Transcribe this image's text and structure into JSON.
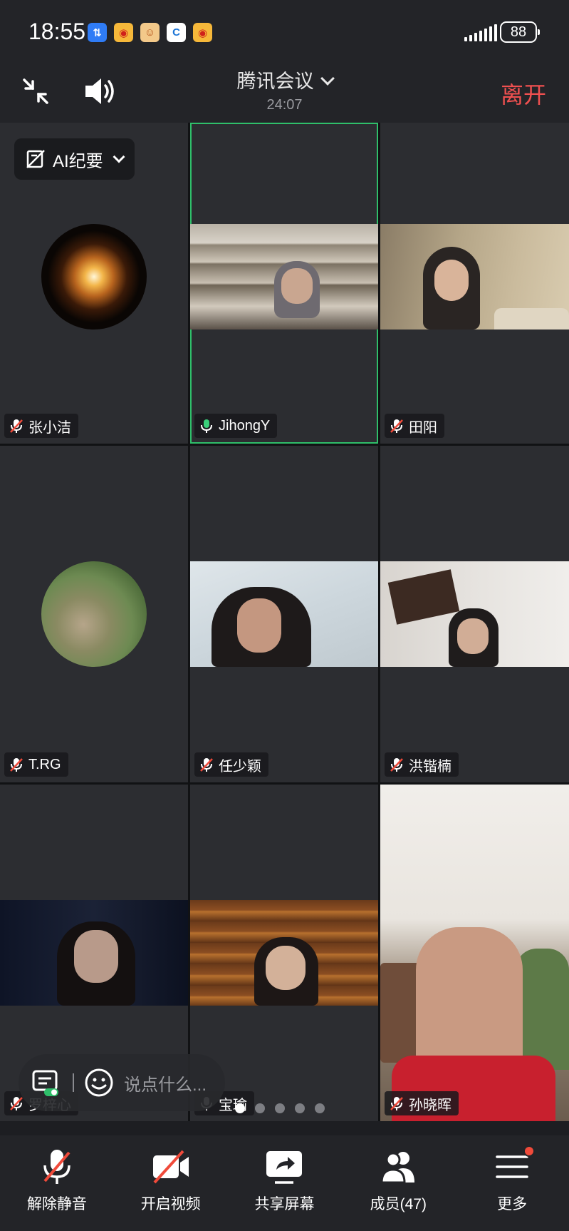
{
  "status_bar": {
    "time": "18:55",
    "battery": "88"
  },
  "header": {
    "title": "腾讯会议",
    "timer": "24:07",
    "leave_label": "离开"
  },
  "ai_summary": {
    "label": "AI纪要"
  },
  "participants": [
    {
      "name": "张小洁",
      "mic": "muted",
      "display": "avatar"
    },
    {
      "name": "JihongY",
      "mic": "on",
      "display": "video",
      "active": true
    },
    {
      "name": "田阳",
      "mic": "muted",
      "display": "video"
    },
    {
      "name": "T.RG",
      "mic": "muted",
      "display": "avatar"
    },
    {
      "name": "任少颖",
      "mic": "muted",
      "display": "video"
    },
    {
      "name": "洪锴楠",
      "mic": "muted",
      "display": "video"
    },
    {
      "name": "罗梓心",
      "mic": "muted",
      "display": "video"
    },
    {
      "name": "宝瑜",
      "mic": "on",
      "display": "video"
    },
    {
      "name": "孙晓晖",
      "mic": "muted",
      "display": "video"
    }
  ],
  "chat": {
    "placeholder": "说点什么..."
  },
  "pagination": {
    "total": 5,
    "active": 0
  },
  "toolbar": {
    "unmute_label": "解除静音",
    "video_label": "开启视频",
    "share_label": "共享屏幕",
    "members_label": "成员(47)",
    "more_label": "更多"
  },
  "colors": {
    "leave": "#f05050",
    "active_speaker": "#2fbf6a",
    "notification": "#f04a3a"
  }
}
